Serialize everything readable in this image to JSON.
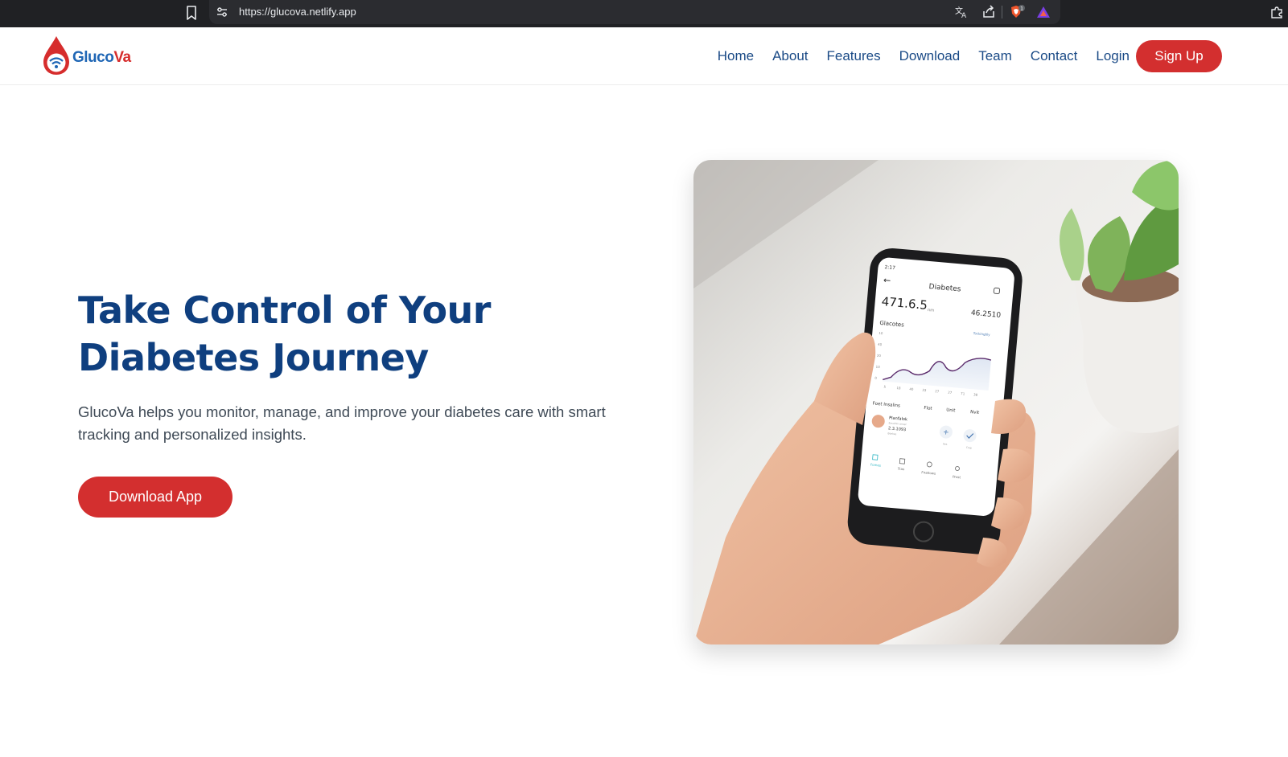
{
  "browser": {
    "url": "https://glucova.netlify.app",
    "icons": [
      "bookmark-icon",
      "site-settings-icon",
      "translate-icon",
      "share-icon",
      "brave-shield-icon",
      "brave-rewards-icon",
      "extensions-icon"
    ],
    "shield_count": "1"
  },
  "navbar": {
    "logo": {
      "part1": "Gluco",
      "part2": "Va",
      "icon": "blood-drop-wifi-icon"
    },
    "links": [
      "Home",
      "About",
      "Features",
      "Download",
      "Team",
      "Contact",
      "Login"
    ],
    "signup_label": "Sign Up"
  },
  "hero": {
    "title_line1": "Take Control of Your",
    "title_line2": "Diabetes Journey",
    "description": "GlucoVa helps you monitor, manage, and improve your diabetes care with smart tracking and personalized insights.",
    "download_label": "Download App"
  },
  "phone_screen": {
    "time": "2:17",
    "title": "Diabetes",
    "reading_main": "471.6.5",
    "reading_unit": "nm",
    "reading_side": "46.2510",
    "chart_label": "Glacotes",
    "chart_tag": "Tockingbly",
    "y_ticks": [
      "10",
      "40",
      "20",
      "10",
      "0"
    ],
    "x_ticks": [
      "5",
      "18",
      "40",
      "33",
      "27",
      "27",
      "71",
      "38"
    ],
    "section_headers": [
      "Foet Insalins",
      "Flot",
      "Unit",
      "Nvit"
    ],
    "entry_name": "Planfalok",
    "entry_sub": "Exsulnin annel",
    "entry_value": "2.3.1093",
    "entry_note": "Bonkes",
    "action_labels": [
      "Ues",
      "Crep"
    ],
    "tabs": [
      "Fomes",
      "Tcas",
      "Fnatlows",
      "Prost"
    ]
  },
  "colors": {
    "brand_blue": "#0f3f7f",
    "nav_blue": "#1a4a86",
    "brand_red": "#d32f2f",
    "logo_blue": "#1f66b5"
  }
}
